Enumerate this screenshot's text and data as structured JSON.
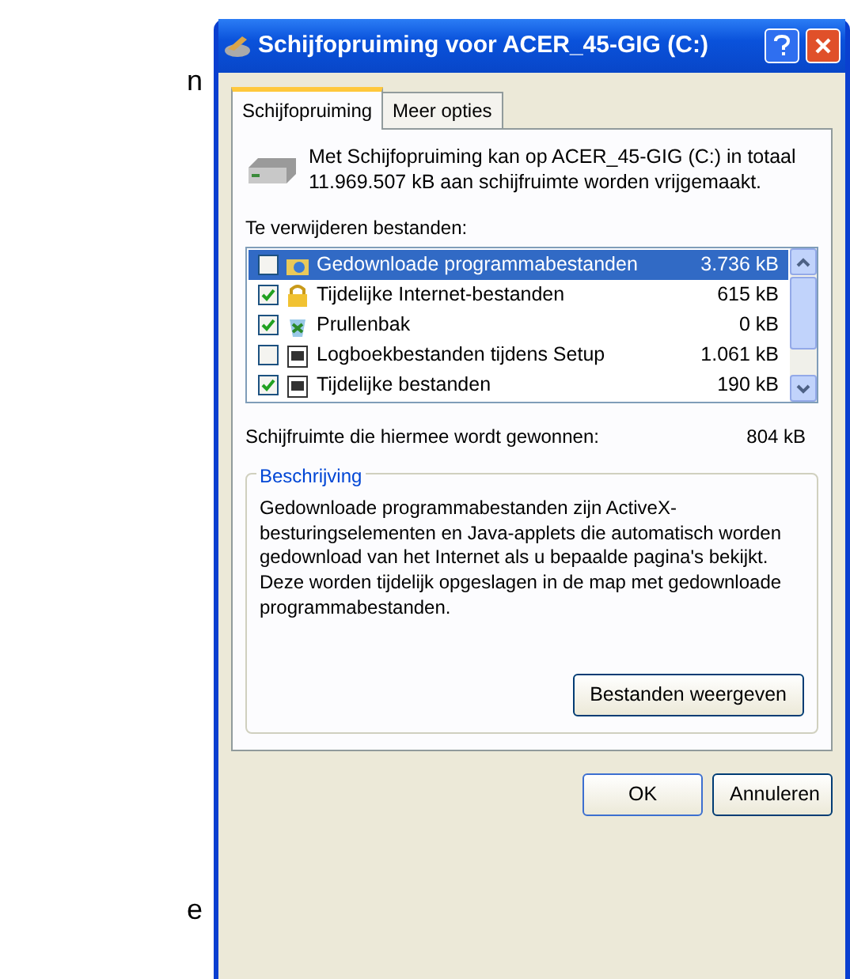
{
  "background_fragments": [
    {
      "text": "n"
    },
    {
      "text": "e"
    }
  ],
  "window": {
    "title": "Schijfopruiming voor ACER_45-GIG (C:)"
  },
  "tabs": [
    {
      "label": "Schijfopruiming",
      "selected": true
    },
    {
      "label": "Meer opties",
      "selected": false
    }
  ],
  "intro": "Met Schijfopruiming kan op ACER_45-GIG (C:) in totaal 11.969.507 kB aan schijfruimte worden vrijgemaakt.",
  "files_label": "Te verwijderen bestanden:",
  "files": [
    {
      "name": "Gedownloade programmabestanden",
      "size": "3.736 kB",
      "checked": false,
      "selected": true,
      "kind": "folder"
    },
    {
      "name": "Tijdelijke Internet-bestanden",
      "size": "615 kB",
      "checked": true,
      "selected": false,
      "kind": "lock"
    },
    {
      "name": "Prullenbak",
      "size": "0 kB",
      "checked": true,
      "selected": false,
      "kind": "bin"
    },
    {
      "name": "Logboekbestanden tijdens Setup",
      "size": "1.061 kB",
      "checked": false,
      "selected": false,
      "kind": "doc"
    },
    {
      "name": "Tijdelijke bestanden",
      "size": "190 kB",
      "checked": true,
      "selected": false,
      "kind": "doc"
    }
  ],
  "gained": {
    "label": "Schijfruimte die hiermee wordt gewonnen:",
    "value": "804 kB"
  },
  "description": {
    "title": "Beschrijving",
    "text": "Gedownloade programmabestanden zijn ActiveX-besturingselementen en Java-applets die automatisch worden gedownload van het Internet als u bepaalde pagina's bekijkt. Deze worden tijdelijk opgeslagen in de map met gedownloade programmabestanden.",
    "button": "Bestanden weergeven"
  },
  "buttons": [
    "OK",
    "Annuleren"
  ]
}
